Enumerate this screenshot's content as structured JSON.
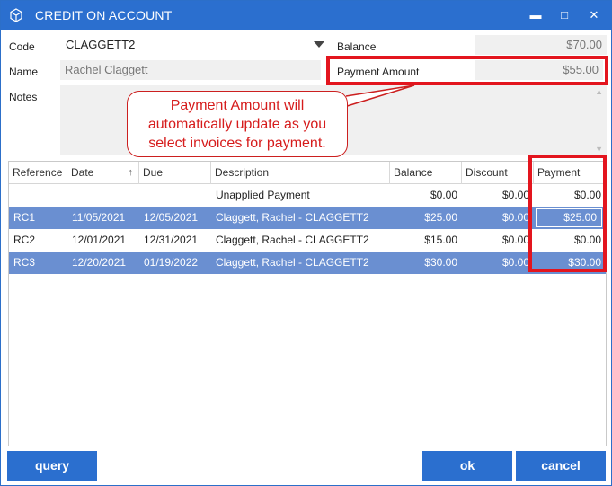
{
  "window": {
    "title": "CREDIT ON ACCOUNT"
  },
  "form": {
    "code_label": "Code",
    "code_value": "CLAGGETT2",
    "name_label": "Name",
    "name_value": "Rachel Claggett",
    "notes_label": "Notes",
    "balance_label": "Balance",
    "balance_value": "$70.00",
    "payment_amount_label": "Payment Amount",
    "payment_amount_value": "$55.00"
  },
  "callout": {
    "line1": "Payment Amount will",
    "line2": "automatically update as you",
    "line3": "select invoices for payment."
  },
  "grid": {
    "columns": [
      "Reference",
      "Date",
      "Due",
      "Description",
      "Balance",
      "Discount",
      "Payment"
    ],
    "rows": [
      {
        "reference": "",
        "date": "",
        "due": "",
        "description": "Unapplied Payment",
        "balance": "$0.00",
        "discount": "$0.00",
        "payment": "$0.00",
        "selected": false
      },
      {
        "reference": "RC1",
        "date": "11/05/2021",
        "due": "12/05/2021",
        "description": "Claggett, Rachel - CLAGGETT2",
        "balance": "$25.00",
        "discount": "$0.00",
        "payment": "$25.00",
        "selected": true
      },
      {
        "reference": "RC2",
        "date": "12/01/2021",
        "due": "12/31/2021",
        "description": "Claggett, Rachel - CLAGGETT2",
        "balance": "$15.00",
        "discount": "$0.00",
        "payment": "$0.00",
        "selected": false
      },
      {
        "reference": "RC3",
        "date": "12/20/2021",
        "due": "01/19/2022",
        "description": "Claggett, Rachel - CLAGGETT2",
        "balance": "$30.00",
        "discount": "$0.00",
        "payment": "$30.00",
        "selected": true
      }
    ]
  },
  "buttons": {
    "query": "query",
    "ok": "ok",
    "cancel": "cancel"
  },
  "colors": {
    "accent": "#2b6fcf",
    "selected_row": "#6a8fd1",
    "highlight_red": "#e3151e"
  }
}
